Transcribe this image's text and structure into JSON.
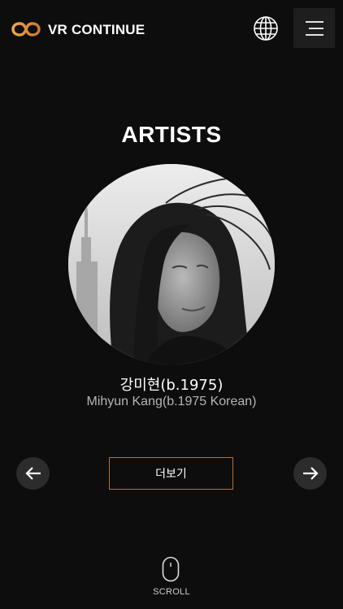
{
  "header": {
    "brand": "VR CONTINUE",
    "logo_icon": "infinity-logo-icon",
    "globe_icon": "globe-icon",
    "menu_icon": "hamburger-menu-icon"
  },
  "main": {
    "title": "ARTISTS",
    "artist": {
      "name_ko": "강미현(b.1975)",
      "name_en": "Mihyun Kang(b.1975 Korean)"
    },
    "more_label": "더보기",
    "prev_icon": "arrow-left-icon",
    "next_icon": "arrow-right-icon"
  },
  "footer": {
    "scroll_label": "SCROLL",
    "scroll_icon": "mouse-icon"
  },
  "colors": {
    "background": "#0d0d0d",
    "accent_orange": "#e0913f",
    "button_border": "#b5703a",
    "nav_circle": "#2c2c2c"
  }
}
